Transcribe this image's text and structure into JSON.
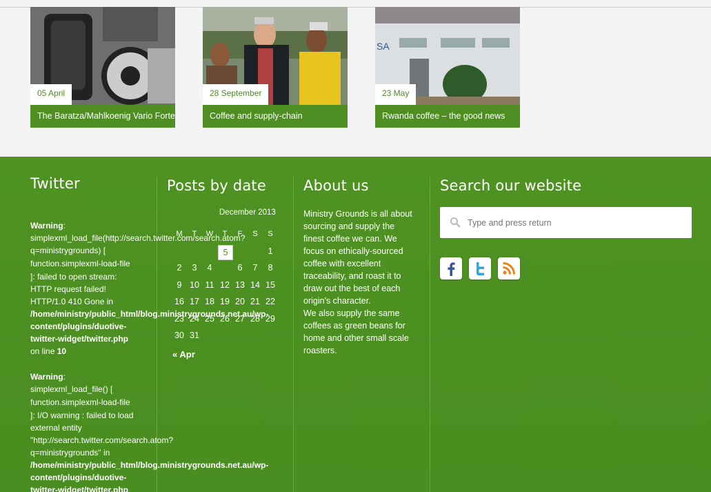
{
  "posts": [
    {
      "date": "05 April",
      "title": "The Baratza/Mahlkoenig Vario Forte"
    },
    {
      "date": "28 September",
      "title": "Coffee and supply-chain"
    },
    {
      "date": "23 May",
      "title": "Rwanda coffee – the good news"
    }
  ],
  "footer": {
    "twitter": {
      "heading": "Twitter",
      "warning1": {
        "label": "Warning",
        "colon": ":",
        "line1": "simplexml_load_file(http://search.twitter.com/search.atom?",
        "line2": "q=ministrygrounds) [",
        "func": "function.simplexml-load-file",
        "line3": "]: failed to open stream:",
        "line4": "HTTP request failed!",
        "line5": "HTTP/1.0 410 Gone in",
        "path1": "/home/ministry/public_html/blog.ministrygrounds.net.au/wp-",
        "path2": "content/plugins/duotive-",
        "path3": "twitter-widget/twitter.php",
        "online": "on line",
        "lineno": "10"
      },
      "warning2": {
        "label": "Warning",
        "colon": ":",
        "line1": "simplexml_load_file() [",
        "func": "function.simplexml-load-file",
        "line2": "]: I/O warning : failed to load",
        "line3": "external entity",
        "line4": "\"http://search.twitter.com/search.atom?",
        "line5": "q=ministrygrounds\" in",
        "path1": "/home/ministry/public_html/blog.ministrygrounds.net.au/wp-",
        "path2": "content/plugins/duotive-",
        "path3": "twitter-widget/twitter.php"
      }
    },
    "calendar": {
      "heading": "Posts by date",
      "month": "December 2013",
      "weekdays": [
        "M",
        "T",
        "W",
        "T",
        "F",
        "S",
        "S"
      ],
      "rows": [
        [
          "",
          "",
          "",
          "",
          "",
          "",
          "1"
        ],
        [
          "2",
          "3",
          "4",
          "5",
          "6",
          "7",
          "8"
        ],
        [
          "9",
          "10",
          "11",
          "12",
          "13",
          "14",
          "15"
        ],
        [
          "16",
          "17",
          "18",
          "19",
          "20",
          "21",
          "22"
        ],
        [
          "23",
          "24",
          "25",
          "26",
          "27",
          "28",
          "29"
        ],
        [
          "30",
          "31",
          "",
          "",
          "",
          "",
          ""
        ]
      ],
      "today": "5",
      "prev_link": "« Apr"
    },
    "about": {
      "heading": "About us",
      "lines1": [
        "Ministry Grounds is all about",
        "sourcing and supply the",
        "finest coffee we can. We",
        "focus on ethically-sourced",
        "coffee with excellent",
        "traceability, and roast it to",
        "draw out the best of each",
        "origin's character."
      ],
      "lines2": [
        "We also supply the same",
        "coffees as green beans for",
        "home and other small scale",
        "roasters."
      ]
    },
    "search": {
      "heading": "Search our website",
      "placeholder": "Type and press return"
    },
    "social": [
      "facebook-icon",
      "twitter-icon",
      "rss-icon"
    ],
    "colors": {
      "green": "#4e8e22",
      "twitter_blue": "#29a9e1",
      "facebook_blue": "#3b5998",
      "rss_orange": "#e8841f"
    }
  }
}
